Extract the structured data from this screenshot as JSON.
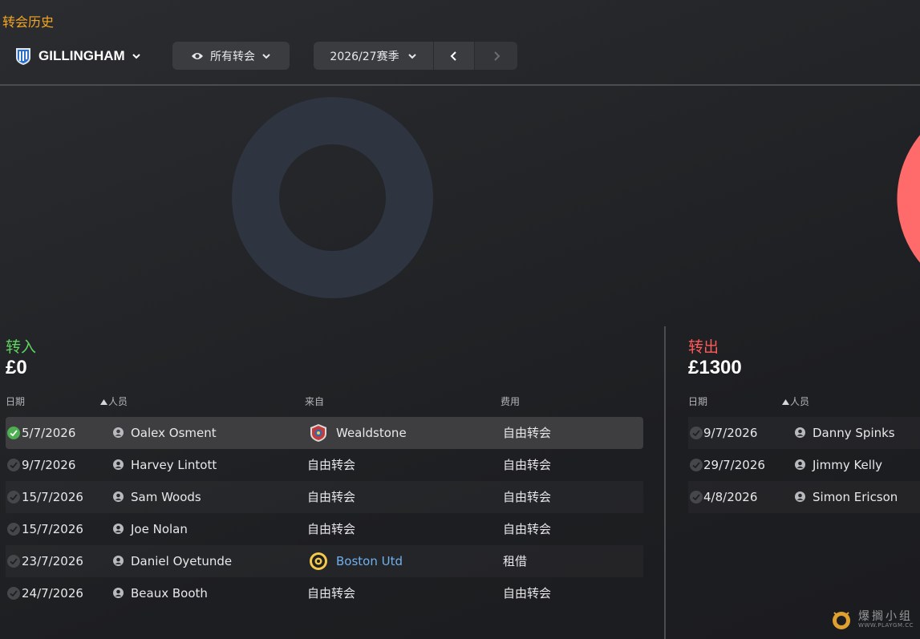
{
  "page": {
    "title": "转会历史"
  },
  "toolbar": {
    "club_name": "GILLINGHAM",
    "filter_label": "所有转会",
    "season_label": "2026/27赛季"
  },
  "incoming": {
    "label": "转入",
    "total": "£0",
    "headers": {
      "date": "日期",
      "person": "人员",
      "from": "来自",
      "fee": "费用"
    },
    "rows": [
      {
        "date": "5/7/2026",
        "person": "Oalex Osment",
        "from": "Wealdstone",
        "fee": "自由转会"
      },
      {
        "date": "9/7/2026",
        "person": "Harvey Lintott",
        "from": "自由转会",
        "fee": "自由转会"
      },
      {
        "date": "15/7/2026",
        "person": "Sam Woods",
        "from": "自由转会",
        "fee": "自由转会"
      },
      {
        "date": "15/7/2026",
        "person": "Joe Nolan",
        "from": "自由转会",
        "fee": "自由转会"
      },
      {
        "date": "23/7/2026",
        "person": "Daniel Oyetunde",
        "from": "Boston Utd",
        "fee": "租借"
      },
      {
        "date": "24/7/2026",
        "person": "Beaux Booth",
        "from": "自由转会",
        "fee": "自由转会"
      }
    ]
  },
  "outgoing": {
    "label": "转出",
    "total": "£1300",
    "headers": {
      "date": "日期",
      "person": "人员"
    },
    "rows": [
      {
        "date": "9/7/2026",
        "person": "Danny Spinks"
      },
      {
        "date": "29/7/2026",
        "person": "Jimmy Kelly"
      },
      {
        "date": "4/8/2026",
        "person": "Simon Ericson"
      }
    ]
  },
  "watermark": {
    "text": "爆搁小组",
    "sub": "WWW.PLAYGM.CC"
  },
  "colors": {
    "title": "#f5a623",
    "incoming": "#5fd35f",
    "outgoing": "#ff5a5a",
    "donut_in": "#2e3440",
    "donut_out": "#ff6b6b",
    "link": "#6fb0ee"
  }
}
